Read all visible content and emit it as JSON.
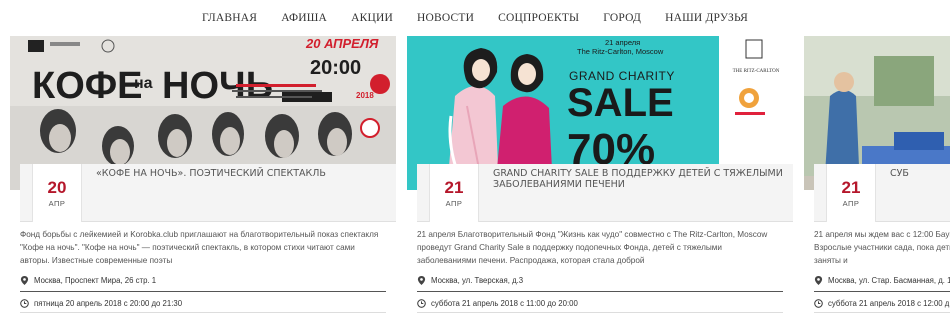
{
  "nav": [
    "ГЛАВНАЯ",
    "АФИША",
    "АКЦИИ",
    "НОВОСТИ",
    "СОЦПРОЕКТЫ",
    "ГОРОД",
    "НАШИ ДРУЗЬЯ"
  ],
  "cards": [
    {
      "poster": {
        "title_part1": "КОФЕ",
        "title_small": "на",
        "title_part2": "НОЧЬ",
        "date": "20 АПРЕЛЯ",
        "time": "20:00",
        "year": "2018"
      },
      "day": "20",
      "month": "АПР",
      "title": "«КОФЕ НА НОЧЬ». ПОЭТИЧЕСКИЙ СПЕКТАКЛЬ",
      "desc": "Фонд борьбы с лейкемией и Korobka.club приглашают на благотворительный показ спектакля \"Кофе на ночь\". \"Кофе на ночь\" — поэтический спектакль, в котором стихи читают сами авторы. Известные современные поэты",
      "location": "Москва, Проспект Мира, 26 стр. 1",
      "time": "пятница 20 апрель 2018 с 20:00 до 21:30"
    },
    {
      "poster": {
        "date": "21 апреля",
        "venue": "The Ritz-Carlton, Moscow",
        "charity": "GRAND CHARITY",
        "sale": "SALE",
        "percent": "70%",
        "logo": "THE RITZ-CARLTON"
      },
      "day": "21",
      "month": "АПР",
      "title": "GRAND CHARITY SALE В ПОДДЕРЖКУ ДЕТЕЙ С ТЯЖЕЛЫМИ ЗАБОЛЕВАНИЯМИ ПЕЧЕНИ",
      "desc": "21 апреля Благотворительный Фонд \"Жизнь как чудо\" совместно с The Ritz-Carlton, Moscow проведут Grand Charity Sale в поддержку подопечных Фонда, детей с тяжелыми заболеваниями печени. Распродажа, которая стала доброй",
      "location": "Москва, ул. Тверская, д.3",
      "time": "суббота 21 апрель 2018 с 11:00 до 20:00"
    },
    {
      "day": "21",
      "month": "АПР",
      "title": "СУБ",
      "desc": "21 апреля мы ждем вас с 12:00 Баумана! Взрослые участники сада, пока дети будут заняты и",
      "location": "Москва, ул. Стар. Басманная, д. 15",
      "time": "суббота 21 апрель 2018 с 12:00 д"
    }
  ],
  "colors": {
    "accent": "#b5172b",
    "teal": "#33c6c6",
    "poster_dark": "#2a2a2a"
  }
}
